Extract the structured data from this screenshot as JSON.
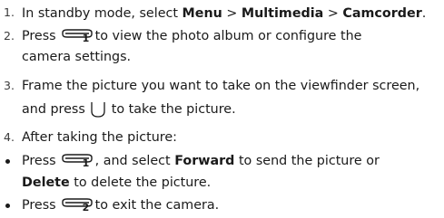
{
  "steps": [
    {
      "num": "1.",
      "pre": "In standby mode, select ",
      "menu": "Menu",
      "sep1": " > ",
      "multimedia": "Multimedia",
      "sep2": " > ",
      "camcorder": "Camcorder",
      "post": "."
    },
    {
      "num": "2.",
      "pre": "Press",
      "key_num": "1",
      "post": "to view the photo album or configure the",
      "cont": "camera settings."
    },
    {
      "num": "3.",
      "line1": "Frame the picture you want to take on the viewfinder screen,",
      "pre": "and press",
      "post": "to take the picture."
    },
    {
      "num": "4.",
      "text": "After taking the picture:"
    }
  ],
  "bullets": [
    {
      "pre": "Press",
      "key_num": "1",
      "mid": ", and select ",
      "forward": "Forward",
      "post": " to send the picture or",
      "delete": "Delete",
      "cont_post": " to delete the picture."
    },
    {
      "pre": "Press",
      "key_num": "2",
      "post": "to exit the camera."
    }
  ],
  "icons": {
    "softkey": "softkey-icon",
    "ok": "ok-key-icon"
  }
}
